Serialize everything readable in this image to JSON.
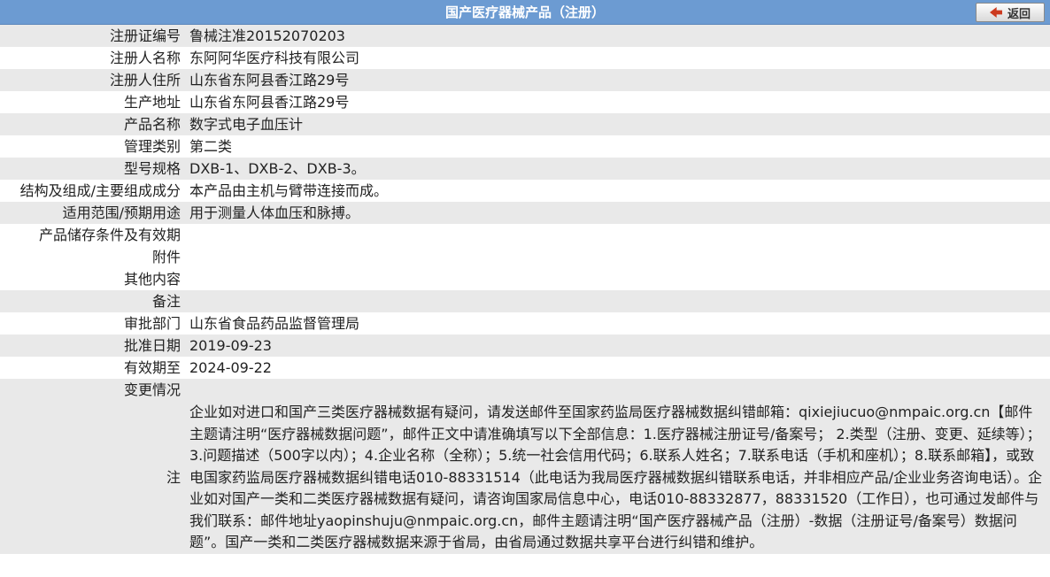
{
  "header": {
    "title": "国产医疗器械产品（注册）",
    "back_label": "返回"
  },
  "rows": [
    {
      "label": "注册证编号",
      "value": "鲁械注准20152070203"
    },
    {
      "label": "注册人名称",
      "value": "东阿阿华医疗科技有限公司"
    },
    {
      "label": "注册人住所",
      "value": "山东省东阿县香江路29号"
    },
    {
      "label": "生产地址",
      "value": "山东省东阿县香江路29号"
    },
    {
      "label": "产品名称",
      "value": "数字式电子血压计"
    },
    {
      "label": "管理类别",
      "value": "第二类"
    },
    {
      "label": "型号规格",
      "value": "DXB-1、DXB-2、DXB-3。"
    },
    {
      "label": "结构及组成/主要组成成分",
      "value": "本产品由主机与臂带连接而成。"
    },
    {
      "label": "适用范围/预期用途",
      "value": "用于测量人体血压和脉搏。"
    },
    {
      "label": "产品储存条件及有效期",
      "value": ""
    },
    {
      "label": "附件",
      "value": ""
    },
    {
      "label": "其他内容",
      "value": ""
    },
    {
      "label": "备注",
      "value": ""
    },
    {
      "label": "审批部门",
      "value": "山东省食品药品监督管理局"
    },
    {
      "label": "批准日期",
      "value": "2019-09-23"
    },
    {
      "label": "有效期至",
      "value": "2024-09-22"
    },
    {
      "label": "变更情况",
      "value": ""
    }
  ],
  "notice": {
    "label": "注",
    "text": "企业如对进口和国产三类医疗器械数据有疑问，请发送邮件至国家药监局医疗器械数据纠错邮箱：qixiejiucuo@nmpaic.org.cn【邮件主题请注明“医疗器械数据问题”，邮件正文中请准确填写以下全部信息：1.医疗器械注册证号/备案号； 2.类型（注册、变更、延续等）；3.问题描述（500字以内）；4.企业名称（全称）；5.统一社会信用代码；6.联系人姓名；7.联系电话（手机和座机）；8.联系邮箱】，或致电国家药监局医疗器械数据纠错电话010-88331514（此电话为我局医疗器械数据纠错联系电话，并非相应产品/企业业务咨询电话）。企业如对国产一类和二类医疗器械数据有疑问，请咨询国家局信息中心，电话010-88332877，88331520（工作日），也可通过发邮件与我们联系：邮件地址yaopinshuju@nmpaic.org.cn，邮件主题请注明“国产医疗器械产品（注册）-数据（注册证号/备案号）数据问题”。国产一类和二类医疗器械数据来源于省局，由省局通过数据共享平台进行纠错和维护。"
  }
}
